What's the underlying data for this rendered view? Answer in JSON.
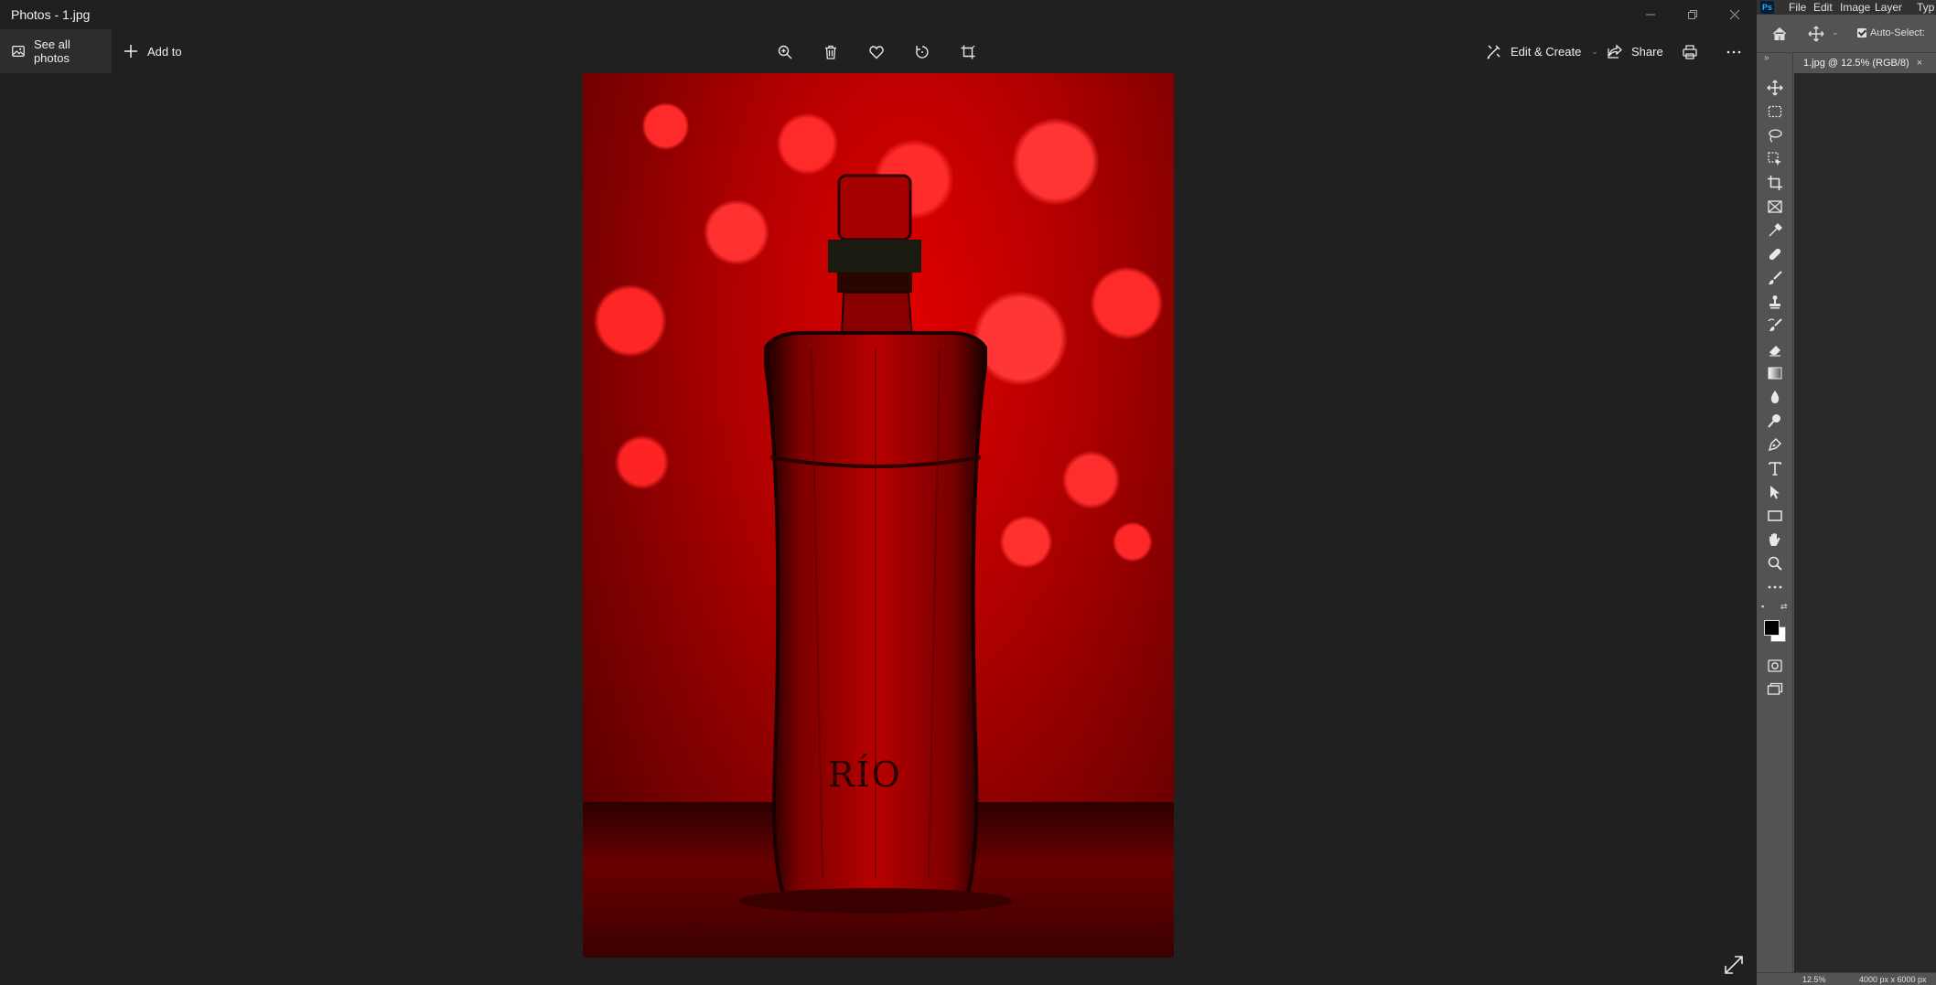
{
  "window": {
    "title": "Photos - 1.jpg"
  },
  "toolbar": {
    "see_all_photos": "See all photos",
    "add_to": "Add to",
    "edit_create": "Edit & Create",
    "share": "Share",
    "icons": [
      "zoom-in-icon",
      "delete-icon",
      "favorite-icon",
      "rotate-icon",
      "crop-icon",
      "print-icon",
      "more-icon"
    ]
  },
  "photo": {
    "label_text": "RÍO"
  },
  "photoshop": {
    "menu": [
      "File",
      "Edit",
      "Image",
      "Layer",
      "Typ"
    ],
    "options": {
      "auto_select": "Auto-Select:"
    },
    "document_tab": "1.jpg @ 12.5% (RGB/8)",
    "status": {
      "zoom": "12.5%",
      "dimensions": "4000 px x 6000 px"
    },
    "tools": [
      "move-tool",
      "marquee-tool",
      "lasso-tool",
      "object-select-tool",
      "crop-tool",
      "frame-tool",
      "eyedropper-tool",
      "healing-tool",
      "brush-tool",
      "stamp-tool",
      "history-brush-tool",
      "eraser-tool",
      "gradient-tool",
      "blur-tool",
      "dodge-tool",
      "pen-tool",
      "type-tool",
      "path-select-tool",
      "rectangle-tool",
      "hand-tool",
      "zoom-tool",
      "more-tools"
    ]
  },
  "colors": {
    "photos_bg": "#202020",
    "ps_panel": "#535353",
    "ps_canvas": "#282828",
    "photo_red": "#d40000"
  }
}
